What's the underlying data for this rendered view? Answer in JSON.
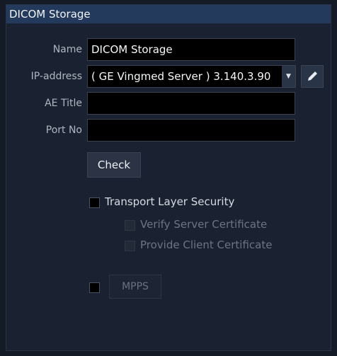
{
  "window": {
    "title": "DICOM Storage"
  },
  "form": {
    "name": {
      "label": "Name",
      "value": "DICOM Storage"
    },
    "ip_address": {
      "label": "IP-address",
      "value": "( GE Vingmed Server ) 3.140.3.90"
    },
    "ae_title": {
      "label": "AE Title",
      "value": ""
    },
    "port_no": {
      "label": "Port No",
      "value": ""
    },
    "check_button": "Check"
  },
  "security": {
    "transport_layer_security": {
      "label": "Transport Layer Security",
      "checked": false
    },
    "verify_server_certificate": {
      "label": "Verify Server Certificate",
      "checked": false,
      "enabled": false
    },
    "provide_client_certificate": {
      "label": "Provide Client Certificate",
      "checked": false,
      "enabled": false
    }
  },
  "mpps": {
    "checked": false,
    "button_label": "MPPS"
  },
  "icons": {
    "dropdown": "chevron-down-icon",
    "edit": "pencil-icon"
  },
  "colors": {
    "title_bar": "#233a5d",
    "panel": "#1a2130",
    "field": "#000000"
  }
}
